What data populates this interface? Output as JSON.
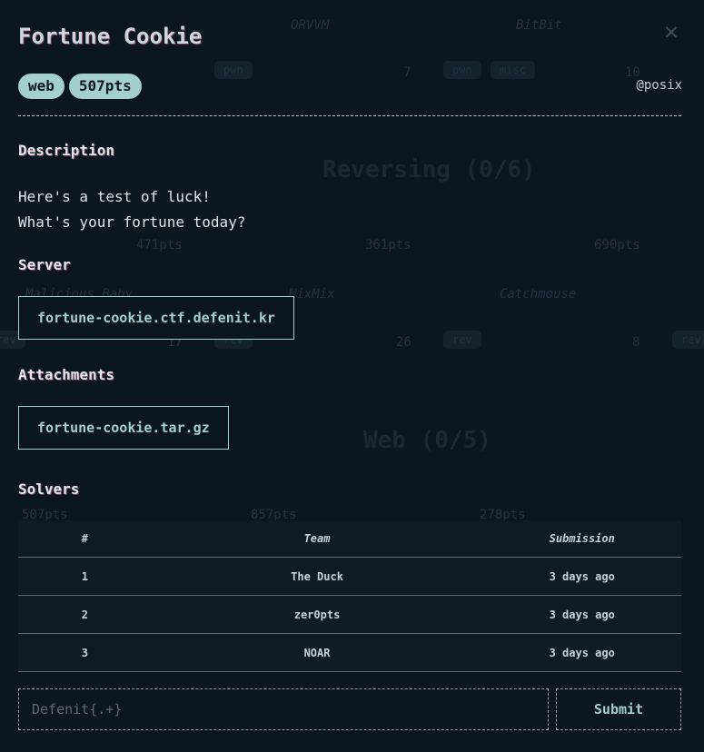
{
  "background": {
    "titles": [
      "ORVVM",
      "BitBit",
      "Malicious Baby",
      "MixMix",
      "Catchmouse"
    ],
    "numbers": [
      "7",
      "10",
      "17",
      "26",
      "8"
    ],
    "pills": [
      "pwn",
      "pwn",
      "misc",
      "rev",
      "rev",
      "rev",
      "rev"
    ],
    "points": [
      "471pts",
      "361pts",
      "690pts",
      "507pts",
      "857pts",
      "278pts"
    ],
    "headings": [
      "Reversing (0/6)",
      "Web (0/5)"
    ]
  },
  "modal": {
    "title": "Fortune Cookie",
    "close": "✕",
    "tags": [
      "web",
      "507pts"
    ],
    "author": "@posix",
    "sections": {
      "description": "Description",
      "server": "Server",
      "attachments": "Attachments",
      "solvers": "Solvers"
    },
    "description_lines": [
      "Here's a test of luck!",
      "What's your fortune today?"
    ],
    "server": "fortune-cookie.ctf.defenit.kr",
    "attachment": "fortune-cookie.tar.gz",
    "solvers_table": {
      "headers": [
        "#",
        "Team",
        "Submission"
      ],
      "rows": [
        [
          "1",
          "The Duck",
          "3 days ago"
        ],
        [
          "2",
          "zer0pts",
          "3 days ago"
        ],
        [
          "3",
          "NOAR",
          "3 days ago"
        ]
      ]
    },
    "flag_placeholder": "Defenit{.+}",
    "submit_label": "Submit"
  },
  "colors": {
    "background": "#0b1620",
    "accent": "#a3cfd0",
    "text": "#dfe8ee"
  }
}
